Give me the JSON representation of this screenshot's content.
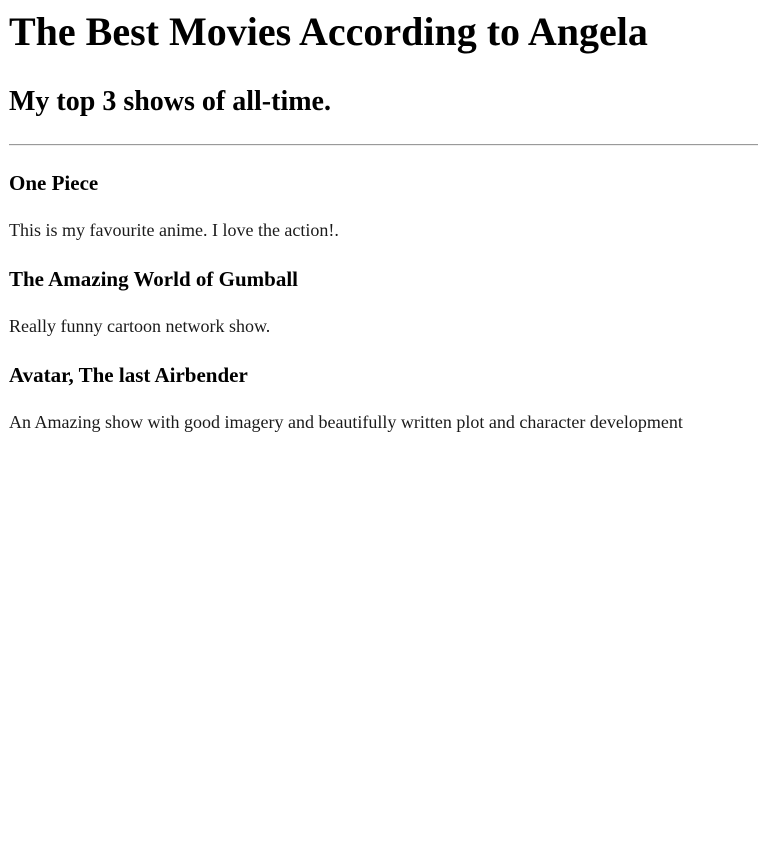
{
  "header": {
    "title": "The Best Movies According to Angela",
    "subtitle": "My top 3 shows of all-time."
  },
  "shows": [
    {
      "title": "One Piece",
      "description": "This is my favourite anime. I love the action!."
    },
    {
      "title": "The Amazing World of Gumball",
      "description": "Really funny cartoon network show."
    },
    {
      "title": "Avatar, The last Airbender",
      "description": "An Amazing show with good imagery and beautifully written plot and character development"
    }
  ]
}
